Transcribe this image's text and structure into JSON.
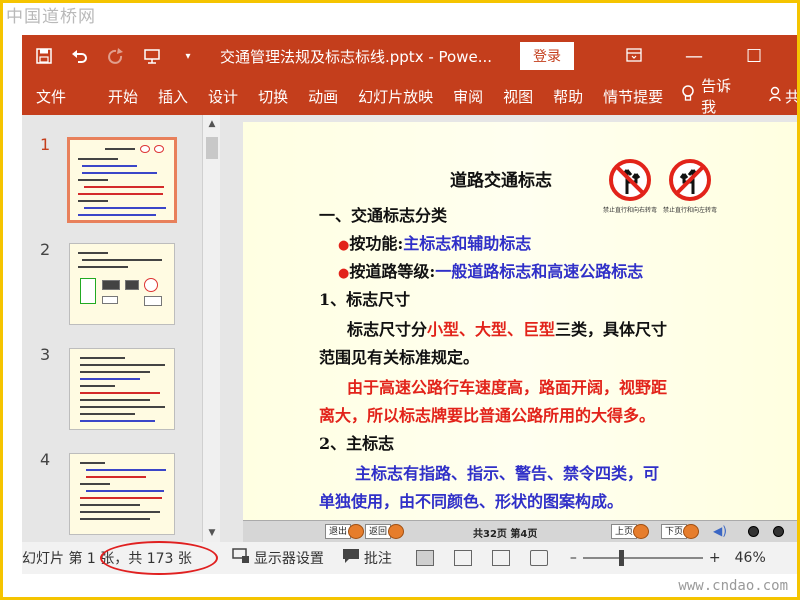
{
  "watermark": {
    "top": "中国道桥网",
    "bottom": "www.cndao.com"
  },
  "titlebar": {
    "document_title": "交通管理法规及标志标线.pptx  -  Powe...",
    "login_label": "登录",
    "icons": [
      "save-icon",
      "undo-icon",
      "redo-icon",
      "present-from-start-icon",
      "customize-toolbar-icon"
    ]
  },
  "ribbon": {
    "tabs": [
      "文件",
      "开始",
      "插入",
      "设计",
      "切换",
      "动画",
      "幻灯片放映",
      "审阅",
      "视图",
      "帮助",
      "情节提要"
    ],
    "tell_me": "告诉我",
    "share_partial": "共"
  },
  "thumbnails": [
    {
      "number": "1",
      "active": true
    },
    {
      "number": "2",
      "active": false
    },
    {
      "number": "3",
      "active": false
    },
    {
      "number": "4",
      "active": false
    }
  ],
  "slide": {
    "title": "道路交通标志",
    "sign_captions": [
      "禁止直行和向右转弯",
      "禁止直行和向左转弯"
    ],
    "line1": "一、交通标志分类",
    "line2_label": "按功能:",
    "line2_value": "主标志和辅助标志",
    "line3_label": "按道路等级:",
    "line3_value": "一般道路标志和高速公路标志",
    "line4": "1、标志尺寸",
    "line5_a": "标志尺寸分",
    "line5_b": "小型、大型、巨型",
    "line5_c": "三类，具体尺寸",
    "line6": "范围见有关标准规定。",
    "line7": "由于高速公路行车速度高，路面开阔，视野距",
    "line8": "离大，所以标志牌要比普通公路所用的大得多。",
    "line9": "2、主标志",
    "line10": "主标志有指路、指示、警告、禁令四类，可",
    "line11": "单独使用，由不同颜色、形状的图案构成。",
    "nav": {
      "exit": "退出",
      "back": "返回",
      "page_info": "共32页 第4页",
      "prev": "上页",
      "next": "下页"
    }
  },
  "statusbar": {
    "slide_info": "幻灯片 第 1 张，共 173 张",
    "display_settings": "显示器设置",
    "comments": "批注",
    "zoom_percent": "46%",
    "zoom_minus": "–",
    "zoom_plus": "+"
  },
  "colors": {
    "accent": "#c43e1c",
    "annotation": "#e02020",
    "slide_blue": "#3030c8",
    "slide_red": "#e2231a"
  }
}
